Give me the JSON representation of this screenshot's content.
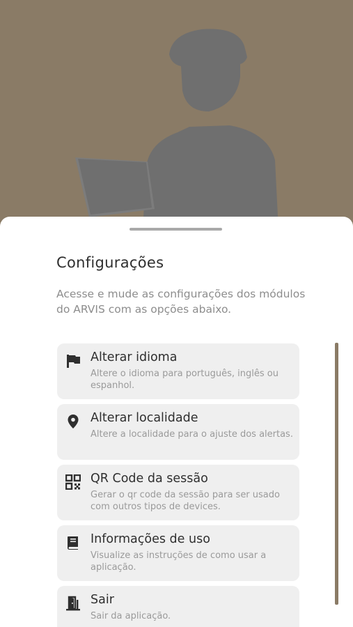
{
  "colors": {
    "hero_bg": "#8a7b66",
    "silhouette": "#6f6f6f",
    "sheet_bg": "#ffffff",
    "card_bg": "#efefef",
    "title_text": "#2f2f2f",
    "muted_text": "#9a9a9a"
  },
  "hero": {
    "image": "person-silhouette-with-clipboard"
  },
  "sheet": {
    "title": "Configurações",
    "subtitle": "Acesse e mude as configurações dos módulos do ARVIS com as opções abaixo.",
    "items": [
      {
        "icon": "flag-icon",
        "label": "Alterar idioma",
        "desc": "Altere o idioma para português, inglês ou espanhol."
      },
      {
        "icon": "location-pin-icon",
        "label": "Alterar localidade",
        "desc": "Altere a localidade para o ajuste dos alertas."
      },
      {
        "icon": "qr-code-icon",
        "label": "QR Code da sessão",
        "desc": "Gerar o qr code da sessão para ser usado com outros tipos de devices."
      },
      {
        "icon": "book-icon",
        "label": "Informações de uso",
        "desc": "Visualize as instruções de como usar a aplicação."
      },
      {
        "icon": "exit-door-icon",
        "label": "Sair",
        "desc": "Sair da aplicação."
      }
    ]
  }
}
